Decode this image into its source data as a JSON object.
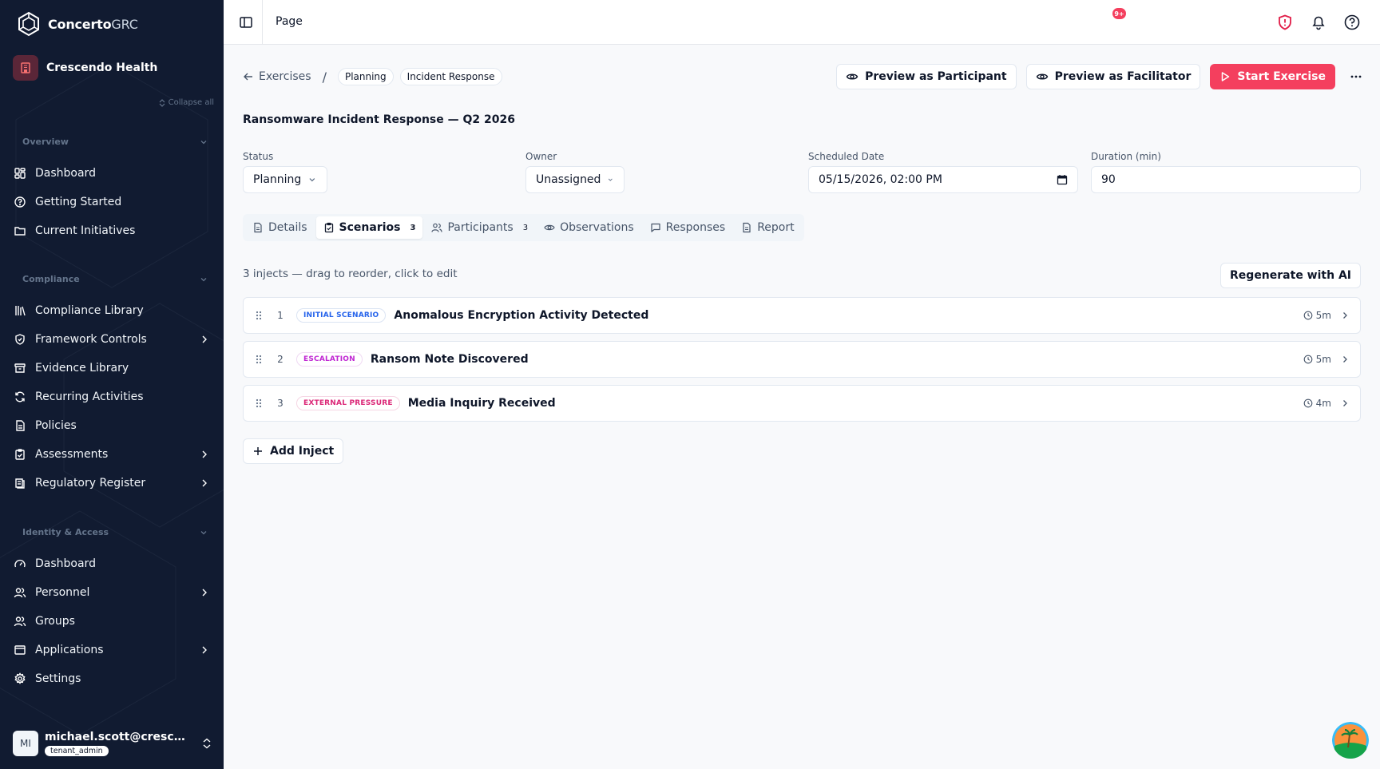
{
  "brand": {
    "name_bold": "Concerto",
    "name_thin": "GRC"
  },
  "tenant": {
    "name": "Crescendo Health"
  },
  "sidebar": {
    "collapse_all": "Collapse all",
    "sections": [
      {
        "title": "Overview",
        "items": [
          {
            "label": "Dashboard",
            "icon": "dashboard-icon"
          },
          {
            "label": "Getting Started",
            "icon": "help-circle-icon"
          },
          {
            "label": "Current Initiatives",
            "icon": "folder-icon"
          }
        ]
      },
      {
        "title": "Compliance",
        "items": [
          {
            "label": "Compliance Library",
            "icon": "library-icon"
          },
          {
            "label": "Framework Controls",
            "icon": "shield-check-icon",
            "has_children": true
          },
          {
            "label": "Evidence Library",
            "icon": "archive-icon"
          },
          {
            "label": "Recurring Activities",
            "icon": "refresh-icon"
          },
          {
            "label": "Policies",
            "icon": "file-text-icon"
          },
          {
            "label": "Assessments",
            "icon": "clipboard-check-icon",
            "has_children": true
          },
          {
            "label": "Regulatory Register",
            "icon": "book-icon",
            "has_children": true
          }
        ]
      },
      {
        "title": "Identity & Access",
        "items": [
          {
            "label": "Dashboard",
            "icon": "gauge-icon"
          },
          {
            "label": "Personnel",
            "icon": "users-icon",
            "has_children": true
          },
          {
            "label": "Groups",
            "icon": "users-group-icon"
          },
          {
            "label": "Applications",
            "icon": "app-window-icon",
            "has_children": true
          },
          {
            "label": "Settings",
            "icon": "gear-icon"
          }
        ]
      }
    ]
  },
  "user": {
    "initials": "MI",
    "email": "michael.scott@crescendohealth.com",
    "role": "tenant_admin"
  },
  "topbar": {
    "page": "Page",
    "notification_badge": "9+"
  },
  "breadcrumb": {
    "back": "Exercises",
    "separator": "/",
    "status_pill": "Planning",
    "type_pill": "Incident Response"
  },
  "actions": {
    "preview_participant": "Preview as Participant",
    "preview_facilitator": "Preview as Facilitator",
    "start": "Start Exercise"
  },
  "exercise": {
    "title": "Ransomware Incident Response — Q2 2026",
    "status_label": "Status",
    "status_value": "Planning",
    "owner_label": "Owner",
    "owner_value": "Unassigned",
    "date_label": "Scheduled Date",
    "date_value": "05/15/2026, 02:00 PM",
    "duration_label": "Duration (min)",
    "duration_value": "90"
  },
  "tabs": [
    {
      "label": "Details",
      "icon": "file-icon"
    },
    {
      "label": "Scenarios",
      "icon": "clipboard-icon",
      "count": "3",
      "active": true
    },
    {
      "label": "Participants",
      "icon": "users-icon",
      "count": "3"
    },
    {
      "label": "Observations",
      "icon": "eye-icon"
    },
    {
      "label": "Responses",
      "icon": "message-square-icon"
    },
    {
      "label": "Report",
      "icon": "file-text-icon"
    }
  ],
  "scenarios": {
    "hint": "3 injects — drag to reorder, click to edit",
    "regenerate": "Regenerate with AI",
    "add_inject": "Add Inject",
    "injects": [
      {
        "number": "1",
        "tag": "INITIAL SCENARIO",
        "tag_color": "#2563eb",
        "title": "Anomalous Encryption Activity Detected",
        "duration": "5m"
      },
      {
        "number": "2",
        "tag": "ESCALATION",
        "tag_color": "#c026d3",
        "title": "Ransom Note Discovered",
        "duration": "5m"
      },
      {
        "number": "3",
        "tag": "EXTERNAL PRESSURE",
        "tag_color": "#db2777",
        "title": "Media Inquiry Received",
        "duration": "4m"
      }
    ]
  },
  "colors": {
    "sidebar_bg": "#111b31",
    "accent": "#f43f5e",
    "tenant_icon_bg": "#5a2638"
  }
}
